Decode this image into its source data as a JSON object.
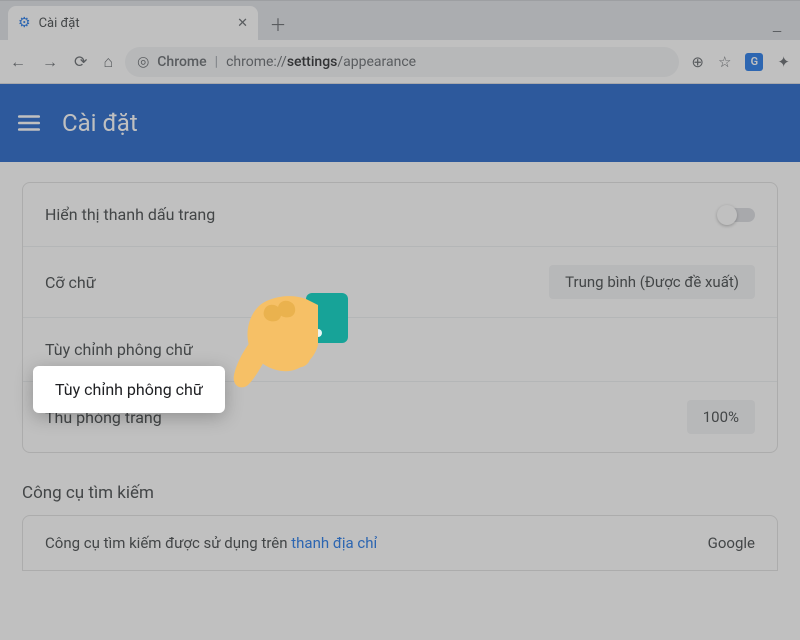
{
  "tab": {
    "favicon": "⚙",
    "title": "Cài đặt"
  },
  "omnibox": {
    "scheme_name": "Chrome",
    "url_prefix": "chrome://",
    "url_bold": "settings",
    "url_suffix": "/appearance"
  },
  "settings_header": {
    "title": "Cài đặt"
  },
  "rows": {
    "bookmarks_bar": "Hiển thị thanh dấu trang",
    "font_size_label": "Cỡ chữ",
    "font_size_value": "Trung bình (Được đề xuất)",
    "customize_fonts": "Tùy chỉnh phông chữ",
    "page_zoom_label": "Thu phóng trang",
    "page_zoom_value": "100%"
  },
  "section2_heading": "Công cụ tìm kiếm",
  "section2_row": {
    "text_prefix": "Công cụ tìm kiếm được sử dụng trên ",
    "link": "thanh địa chỉ",
    "value": "Google"
  }
}
